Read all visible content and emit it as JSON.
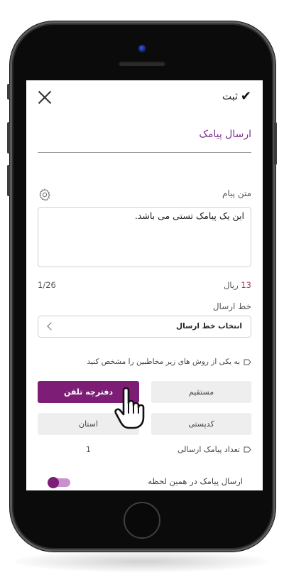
{
  "header": {
    "submit_label": "ثبت",
    "check_icon": "check-icon",
    "close_icon": "close-icon"
  },
  "form": {
    "title": "ارسال پیامک",
    "message_label": "متن پیام",
    "settings_icon": "gear-icon",
    "message_value": "این یک پیامک تستی می باشد.",
    "price_number": "13",
    "price_unit": "ریال",
    "char_counter": "1/26",
    "line_label": "خط ارسال",
    "line_select_value": "انتخاب خط ارسال",
    "recipients_hint": "به یکی از روش های زیر مخاطبین را مشخص کنید",
    "recipient_options": [
      {
        "label": "مستقیم",
        "selected": false
      },
      {
        "label": "دفترچه تلفن",
        "selected": true
      },
      {
        "label": "کدپستی",
        "selected": false
      },
      {
        "label": "استان",
        "selected": false
      }
    ],
    "count_label": "تعداد پیامک ارسالی",
    "count_value": "1",
    "send_now_label": "ارسال پیامک در همین لحظه",
    "send_now_enabled": true
  },
  "colors": {
    "accent": "#7d1d75",
    "title": "#7b2a8c",
    "price": "#a13a6f"
  }
}
